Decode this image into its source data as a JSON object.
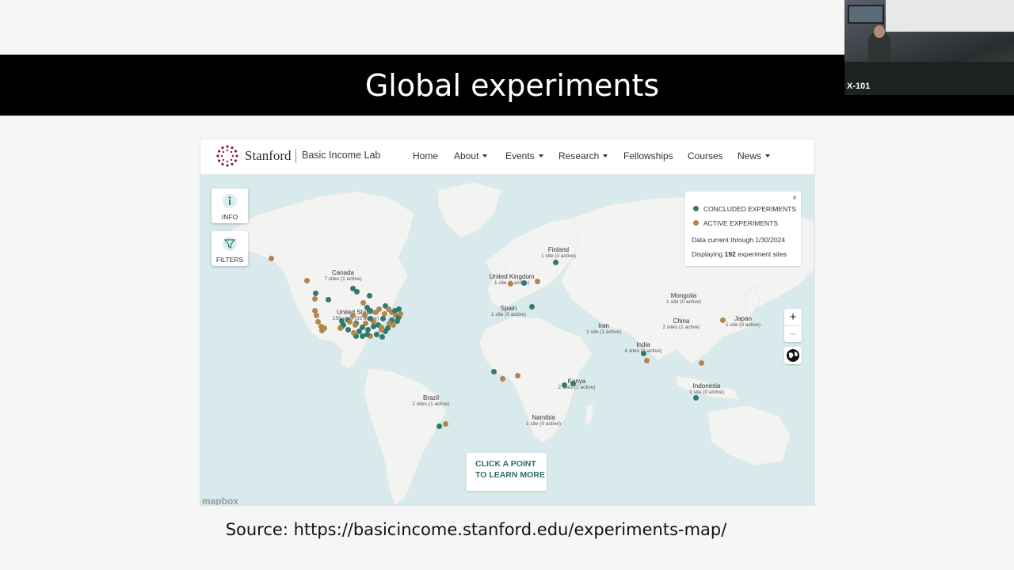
{
  "slide": {
    "title": "Global experiments",
    "source": "Source: https://basicincome.stanford.edu/experiments-map/",
    "camera_label": "X-101"
  },
  "site": {
    "brand": "Stanford",
    "sub_brand": "Basic Income Lab",
    "nav": [
      {
        "label": "Home",
        "dropdown": false
      },
      {
        "label": "About",
        "dropdown": true
      },
      {
        "label": "Events",
        "dropdown": true
      },
      {
        "label": "Research",
        "dropdown": true
      },
      {
        "label": "Fellowships",
        "dropdown": false
      },
      {
        "label": "Courses",
        "dropdown": false
      },
      {
        "label": "News",
        "dropdown": true
      }
    ]
  },
  "map": {
    "controls": {
      "info_label": "INFO",
      "filters_label": "FILTERS"
    },
    "legend": {
      "close": "×",
      "concluded_label": "CONCLUDED EXPERIMENTS",
      "active_label": "ACTIVE EXPERIMENTS",
      "data_current": "Data current through 1/30/2024",
      "displaying_prefix": "Displaying",
      "displaying_count": "192",
      "displaying_suffix": "experiment sites"
    },
    "colors": {
      "concluded": "#2e7a6f",
      "active": "#b3864c",
      "water": "#d9eaec",
      "land": "#f3f3f1"
    },
    "zoom": {
      "plus": "+",
      "minus": "−"
    },
    "cta": {
      "line1": "CLICK A POINT",
      "line2": "TO LEARN MORE"
    },
    "attribution": "mapbox",
    "regions": [
      {
        "name": "Canada",
        "count": "7 sites (1 active)"
      },
      {
        "name": "United States",
        "count": "159 sites (35 active)"
      },
      {
        "name": "United Kingdom",
        "count": "1 site (1 active)"
      },
      {
        "name": "Finland",
        "count": "1 site (0 active)"
      },
      {
        "name": "Spain",
        "count": "1 site (0 active)"
      },
      {
        "name": "Mongolia",
        "count": "1 site (0 active)"
      },
      {
        "name": "Japan",
        "count": "1 site (0 active)"
      },
      {
        "name": "China",
        "count": "2 sites (1 active)"
      },
      {
        "name": "Iran",
        "count": "1 site (1 active)"
      },
      {
        "name": "India",
        "count": "4 sites (2 active)"
      },
      {
        "name": "Kenya",
        "count": "2 sites (1 active)"
      },
      {
        "name": "Indonesia",
        "count": "1 site (0 active)"
      },
      {
        "name": "Brazil",
        "count": "2 sites (1 active)"
      },
      {
        "name": "Namibia",
        "count": "1 site (0 active)"
      }
    ]
  }
}
